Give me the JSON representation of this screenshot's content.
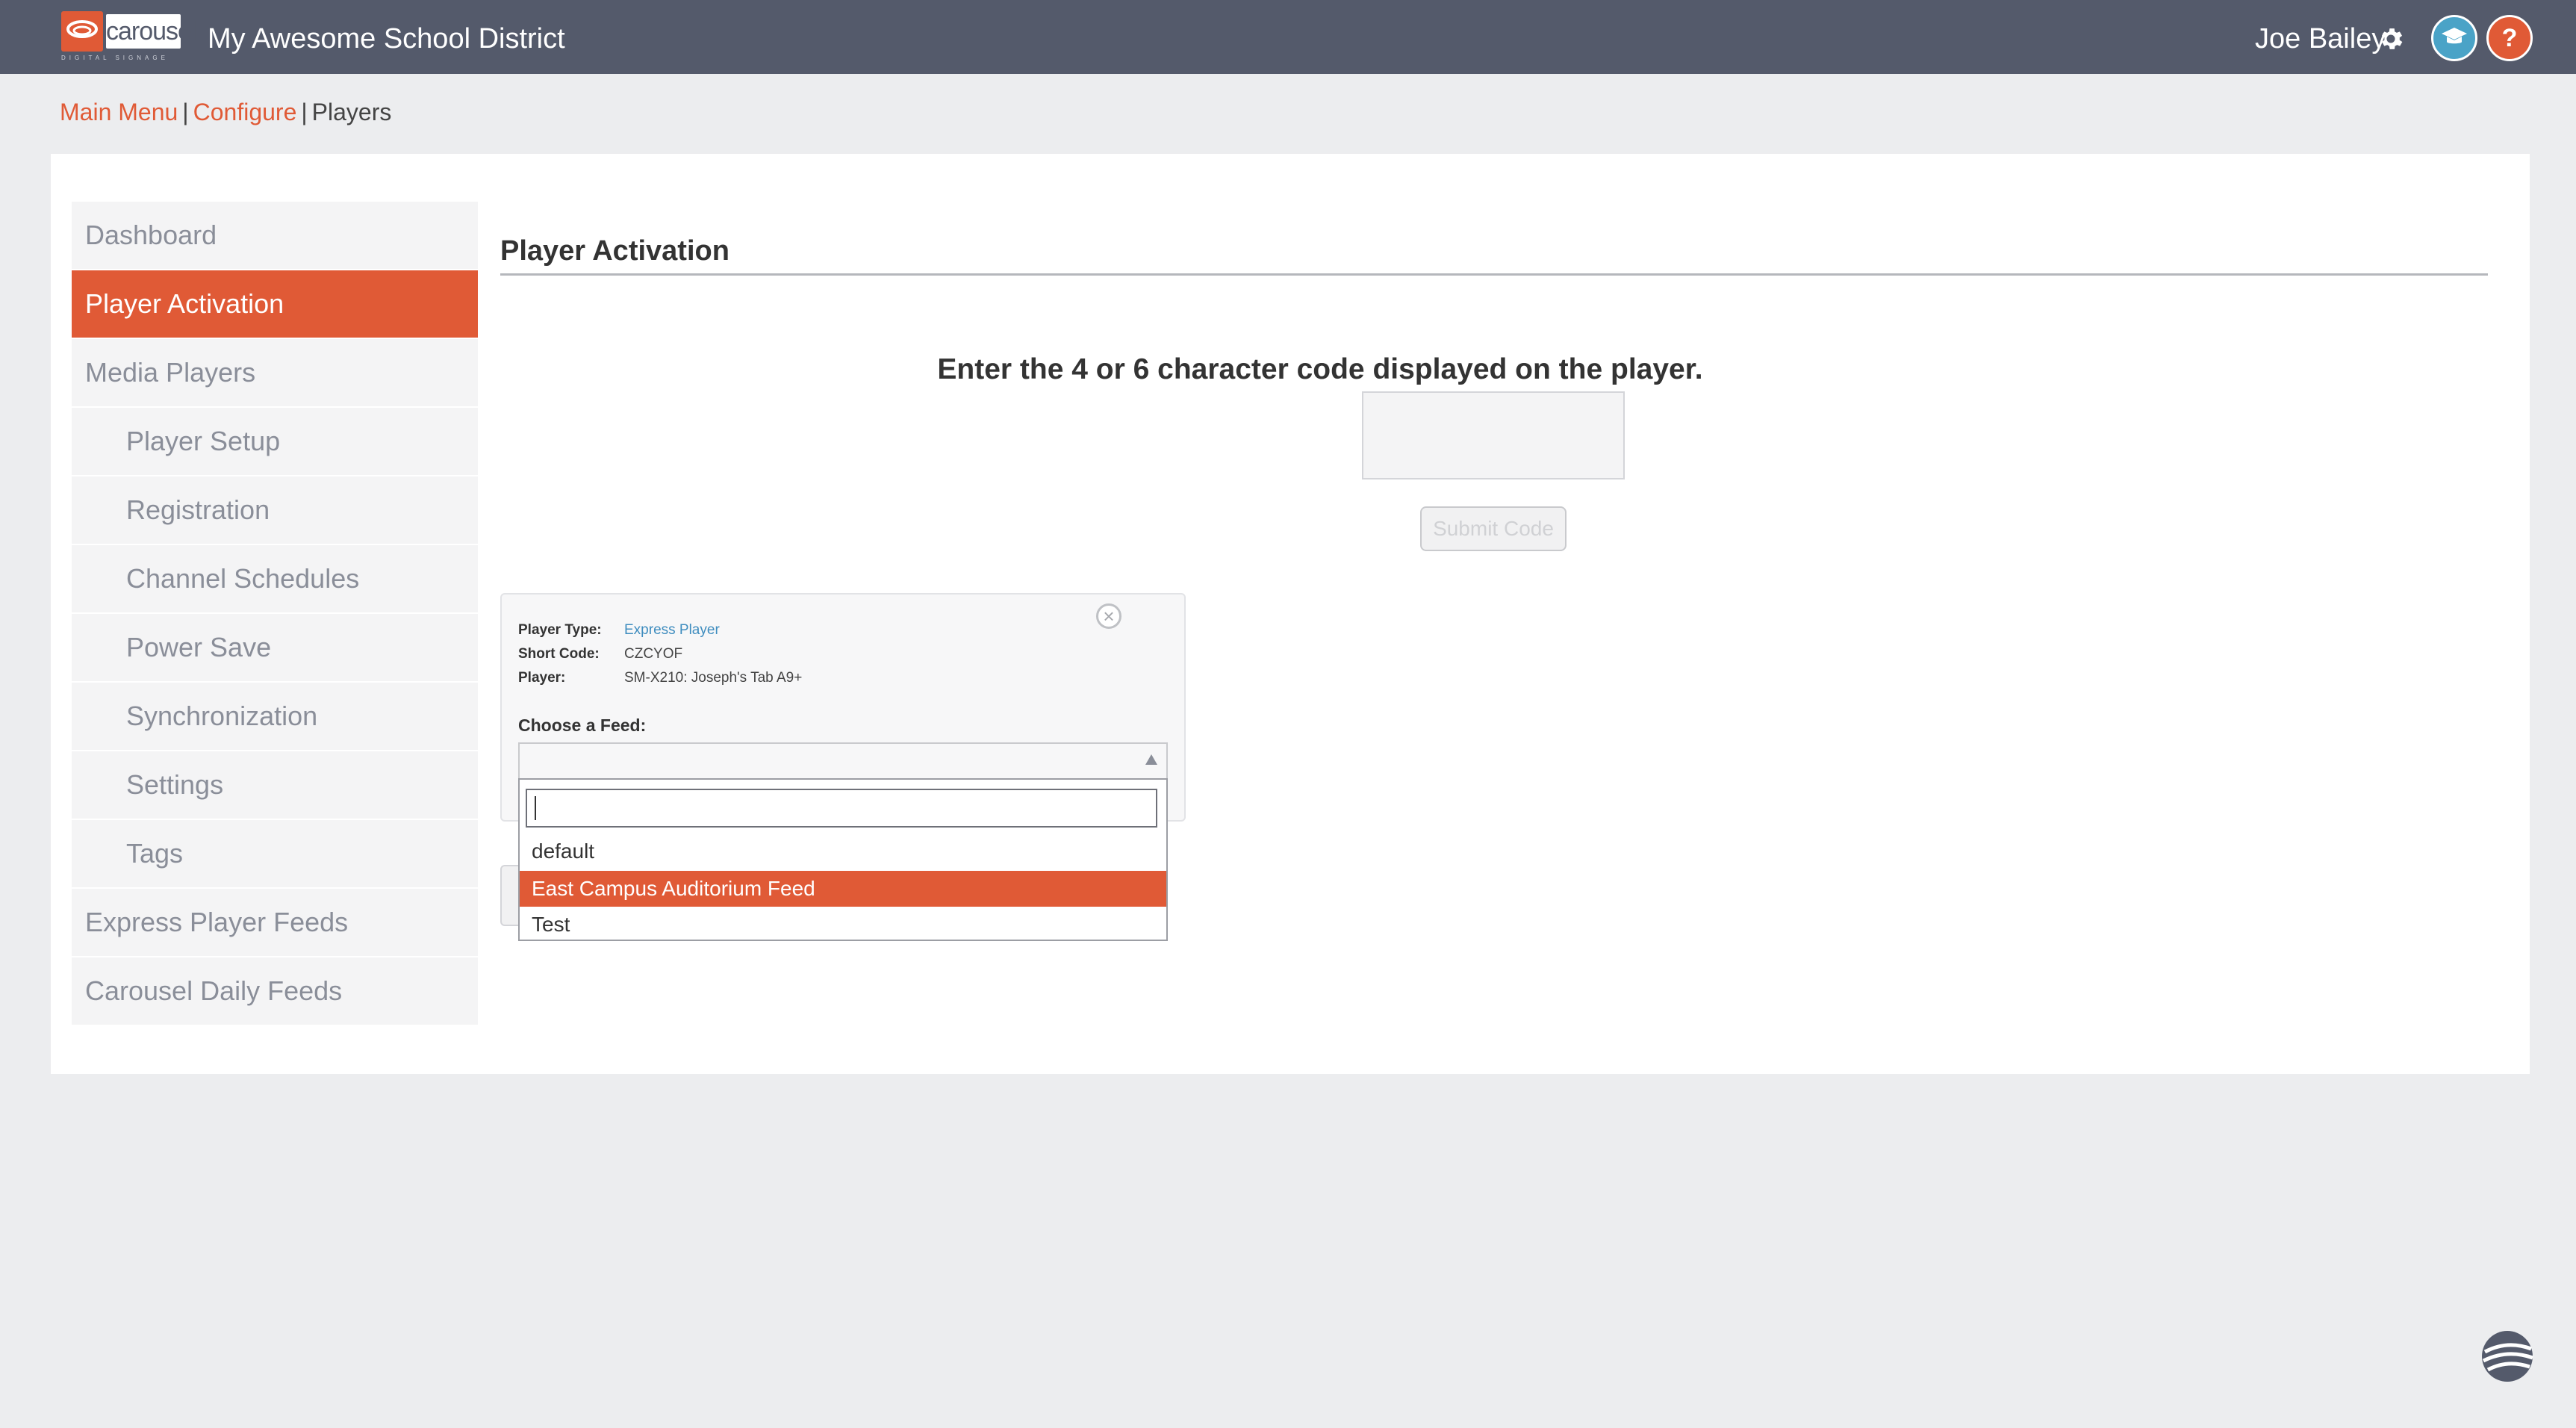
{
  "header": {
    "logo_text": "carousel",
    "logo_subtext": "DIGITAL SIGNAGE",
    "org_name": "My Awesome School District",
    "user_name": "Joe Bailey",
    "help_label": "?"
  },
  "breadcrumb": {
    "items": [
      "Main Menu",
      "Configure",
      "Players"
    ],
    "separator": "|"
  },
  "sidebar": {
    "items": [
      {
        "label": "Dashboard"
      },
      {
        "label": "Player Activation"
      },
      {
        "label": "Media Players"
      },
      {
        "label": "Player Setup"
      },
      {
        "label": "Registration"
      },
      {
        "label": "Channel Schedules"
      },
      {
        "label": "Power Save"
      },
      {
        "label": "Synchronization"
      },
      {
        "label": "Settings"
      },
      {
        "label": "Tags"
      },
      {
        "label": "Express Player Feeds"
      },
      {
        "label": "Carousel Daily Feeds"
      }
    ],
    "active_item": "Player Activation"
  },
  "main": {
    "title": "Player Activation",
    "code_prompt": "Enter the 4 or 6 character code displayed on the player.",
    "code_value": "",
    "submit_label": "Submit Code"
  },
  "player_card": {
    "close_label": "×",
    "player_type_label": "Player Type:",
    "player_type_value": "Express Player",
    "short_code_label": "Short Code:",
    "short_code_value": "CZCYOF",
    "player_label": "Player:",
    "player_value": "SM-X210: Joseph's Tab A9+",
    "feed_label": "Choose a Feed:"
  },
  "feed_dropdown": {
    "search_value": "",
    "options": [
      "default",
      "East Campus Auditorium Feed",
      "Test"
    ],
    "highlighted": "East Campus Auditorium Feed"
  },
  "colors": {
    "accent": "#e05a36",
    "header_bg": "#545a6b",
    "link_blue": "#3f8dbf",
    "graduation_blue": "#4aa3c7"
  }
}
